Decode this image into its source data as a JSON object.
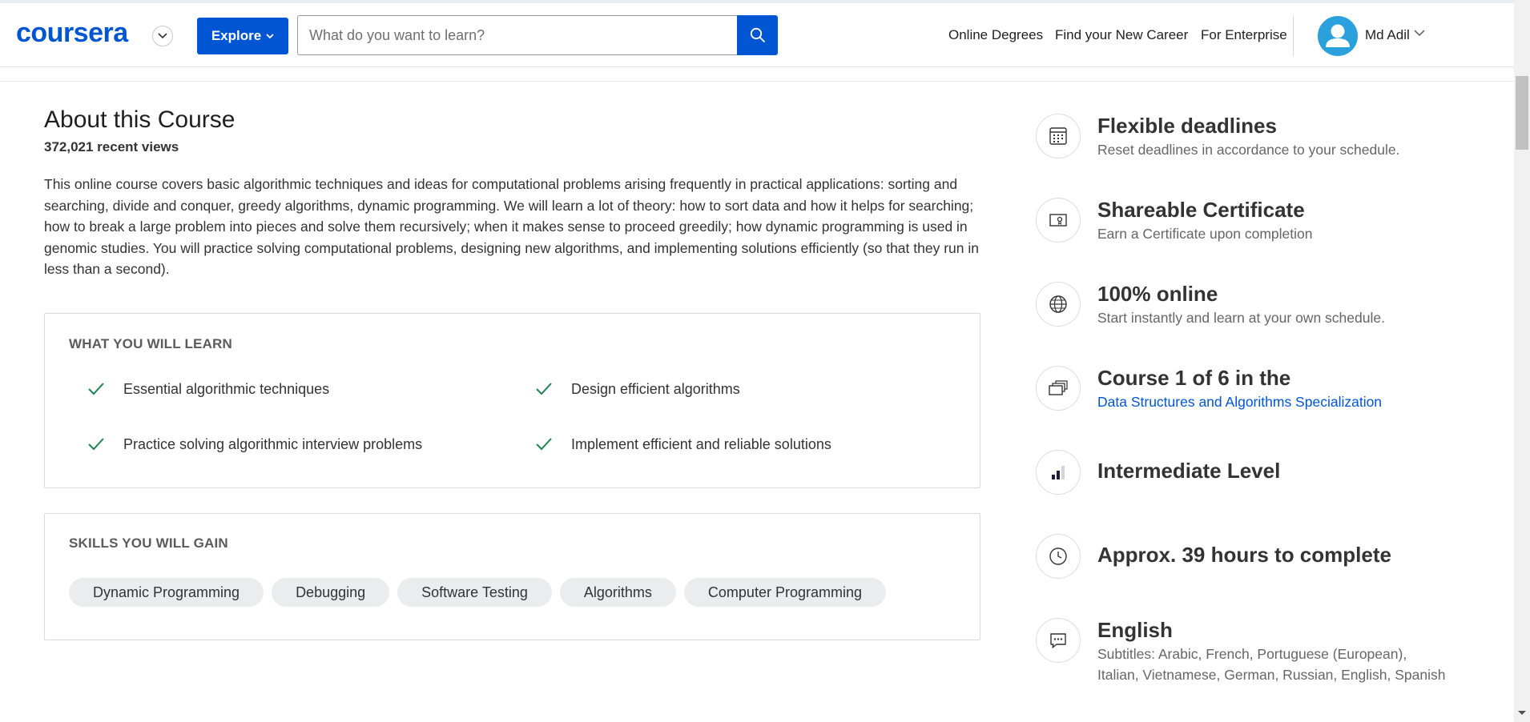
{
  "header": {
    "logo": "coursera",
    "explore_label": "Explore",
    "search_placeholder": "What do you want to learn?",
    "nav": [
      "Online Degrees",
      "Find your New Career",
      "For Enterprise"
    ],
    "user_name": "Md Adil",
    "brand_color": "#0056d2"
  },
  "about": {
    "title": "About this Course",
    "views": "372,021 recent views",
    "description": "This online course covers basic algorithmic techniques and ideas for computational problems arising frequently in practical applications: sorting and searching, divide and conquer, greedy algorithms, dynamic programming. We will learn a lot of theory: how to sort data and how it helps for searching; how to break a large problem into pieces and solve them recursively; when it makes sense to proceed greedily; how dynamic programming is used in genomic studies. You will practice solving computational problems, designing new algorithms, and implementing solutions efficiently (so that they run in less than a second)."
  },
  "learn": {
    "title": "WHAT YOU WILL LEARN",
    "items": [
      "Essential algorithmic techniques",
      "Design efficient algorithms",
      "Practice solving algorithmic interview problems",
      "Implement efficient and reliable solutions"
    ],
    "check_color": "#1f8354"
  },
  "skills": {
    "title": "SKILLS YOU WILL GAIN",
    "items": [
      "Dynamic Programming",
      "Debugging",
      "Software Testing",
      "Algorithms",
      "Computer Programming"
    ]
  },
  "features": [
    {
      "icon": "calendar-icon",
      "title": "Flexible deadlines",
      "subtitle": "Reset deadlines in accordance to your schedule."
    },
    {
      "icon": "certificate-icon",
      "title": "Shareable Certificate",
      "subtitle": "Earn a Certificate upon completion"
    },
    {
      "icon": "globe-icon",
      "title": "100% online",
      "subtitle": "Start instantly and learn at your own schedule."
    },
    {
      "icon": "stack-icon",
      "title": "Course 1 of 6 in the",
      "link": "Data Structures and Algorithms Specialization"
    },
    {
      "icon": "level-icon",
      "title": "Intermediate Level"
    },
    {
      "icon": "clock-icon",
      "title": "Approx. 39 hours to complete"
    },
    {
      "icon": "chat-icon",
      "title": "English",
      "subtitle_line1": "Subtitles: Arabic, French, Portuguese (European),",
      "subtitle_line2": "Italian, Vietnamese, German, Russian, English, Spanish"
    }
  ]
}
